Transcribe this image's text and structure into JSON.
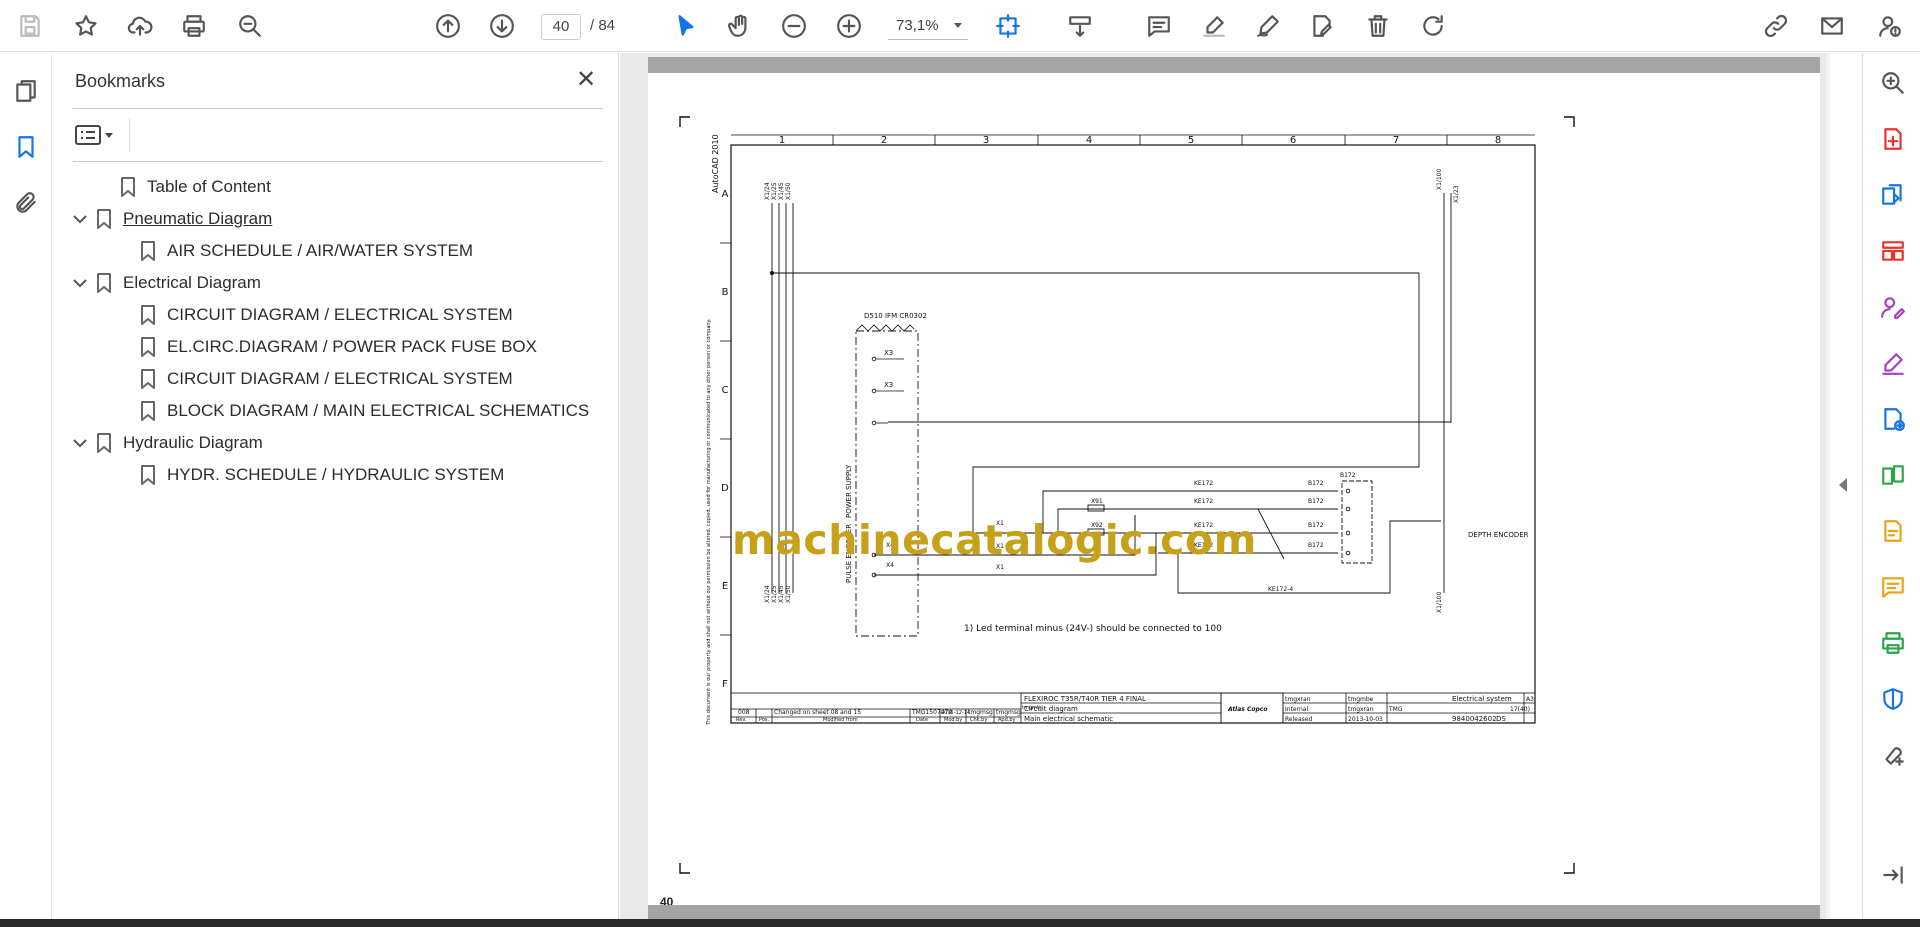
{
  "toolbar": {
    "page_current": "40",
    "page_total": "/ 84",
    "zoom": "73,1%",
    "icons": [
      "save-icon",
      "star-icon",
      "cloud-upload-icon",
      "print-icon",
      "search-zoom-icon",
      "page-up-icon",
      "page-down-icon",
      "select-cursor-icon",
      "hand-icon",
      "zoom-out-icon",
      "zoom-in-icon",
      "fit-page-icon",
      "scroll-mode-icon",
      "comment-icon",
      "highlight-icon",
      "draw-icon",
      "edit-text-icon",
      "delete-icon",
      "rotate-icon",
      "link-share-icon",
      "email-icon",
      "account-help-icon"
    ]
  },
  "bookmarks": {
    "title": "Bookmarks",
    "items": [
      {
        "label": "Table of Content"
      },
      {
        "label": "Pneumatic Diagram"
      },
      {
        "label": "AIR SCHEDULE / AIR/WATER SYSTEM"
      },
      {
        "label": "Electrical Diagram"
      },
      {
        "label": "CIRCUIT DIAGRAM / ELECTRICAL SYSTEM"
      },
      {
        "label": "EL.CIRC.DIAGRAM / POWER PACK FUSE BOX"
      },
      {
        "label": "CIRCUIT DIAGRAM / ELECTRICAL SYSTEM"
      },
      {
        "label": "BLOCK DIAGRAM / MAIN ELECTRICAL SCHEMATICS"
      },
      {
        "label": "Hydraulic Diagram"
      },
      {
        "label": "HYDR. SCHEDULE / HYDRAULIC SYSTEM"
      }
    ]
  },
  "document": {
    "page_number": "40",
    "watermark": "machinecatalogic.com",
    "cols": [
      "1",
      "2",
      "3",
      "4",
      "5",
      "6",
      "7",
      "8"
    ],
    "rows": [
      "A",
      "B",
      "C",
      "D",
      "E",
      "F"
    ],
    "autocad": "AutoCAD 2010",
    "module": "D510 IFM CR0302",
    "power_supply": "POWER SUPPLY",
    "pulse_encoder": "PULSE ENCODER",
    "depth_encoder": "DEPTH ENCODER",
    "note": "1) Led terminal minus (24V-) should be connected to 100",
    "conn_x3": "X3",
    "conn_x1": "X1",
    "conn_x4": "X4",
    "conn_x91": "X91",
    "conn_x92": "X92",
    "ke172": "KE172",
    "b172": "B172",
    "ke172_4": "KE172-4",
    "wire_labels": [
      "X1/24",
      "X1/25",
      "X1/45",
      "X1/50",
      "X1/100",
      "X1/23"
    ],
    "title_block": {
      "project": "FLEXIROC T35R/T40R TIER 4 FINAL",
      "title": "Circuit diagram",
      "subtitle": "Main electrical schematic",
      "rev": "008",
      "change": "Changed on sheet 08 and 15",
      "change_no": "TMG1507474",
      "change_date": "2015-12-14",
      "mod_by": "tmgmsg",
      "chk_by": "tmgmsg",
      "apd_by": "tmgmtn",
      "rev_h": "Rev.",
      "pos_h": "Pos.",
      "modified_from": "Modified from",
      "date_h": "Date",
      "modby_h": "Mod.by",
      "chkby_h": "Chk.by",
      "apdby_h": "Apd.by",
      "drawn": "tmgxran",
      "checked": "tmgxran",
      "approver": "tmgmbe",
      "confidentiality": "Internal",
      "resp_dept": "TMG",
      "status": "Released",
      "date": "2013-10-03",
      "logo": "Atlas Copco",
      "designation": "Electrical system",
      "doc_no": "9840042602",
      "doc_suffix": "DS",
      "format": "A3",
      "sheet": "17(40)"
    },
    "side_text": "This document is our property and shall not without our permission be altered, copied, used for manufacturing or communicated to any other person or company."
  }
}
